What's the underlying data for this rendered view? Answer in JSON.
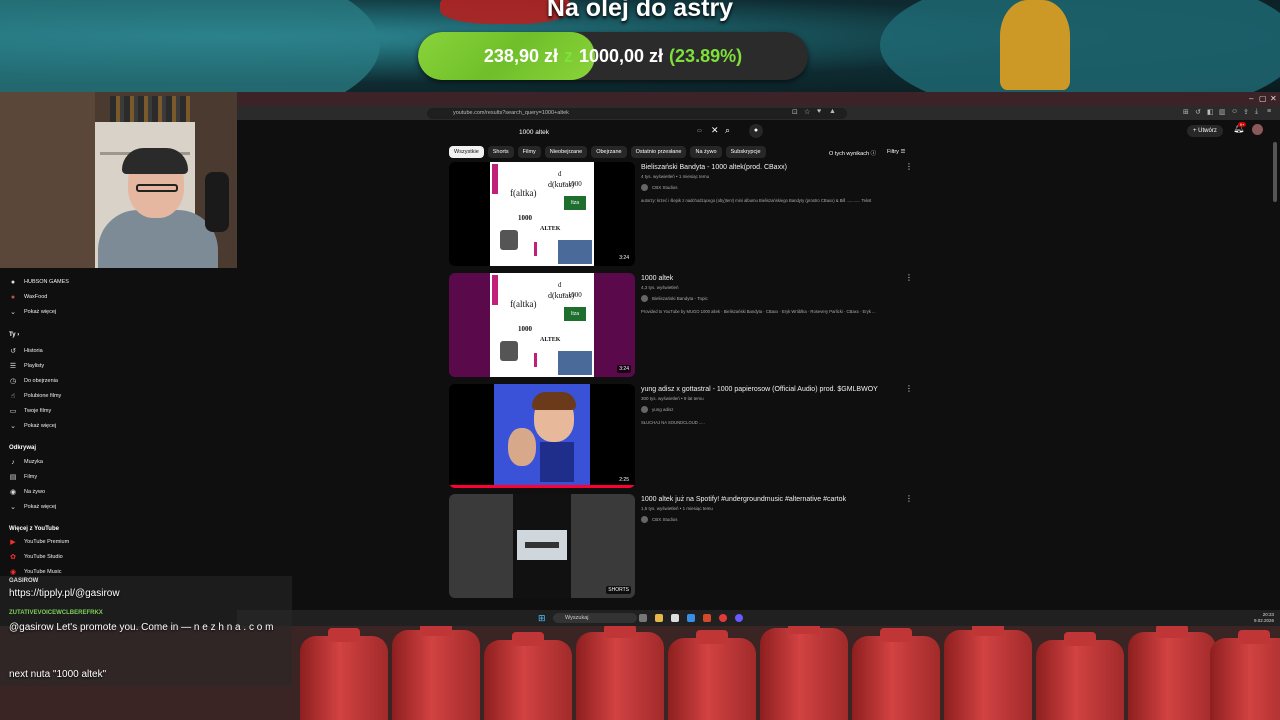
{
  "overlay": {
    "goal_title": "Na olej do astry",
    "goal_current": "238,90 zł",
    "goal_sep": "z",
    "goal_target": "1000,00 zł",
    "goal_percent": "(23.89%)",
    "goal_fraction": 0.2389,
    "accent": "#7ee03a"
  },
  "browser": {
    "url": "youtube.com/results?search_query=1000+altek"
  },
  "youtube": {
    "search_value": "1000 altek",
    "create_label": "Utwórz",
    "notification_count": "9+",
    "chips": [
      "Wszystkie",
      "Shorts",
      "Filmy",
      "Nieobejrzane",
      "Obejrzane",
      "Ostatnio przesłane",
      "Na żywo",
      "Subskrypcje"
    ],
    "about_results": "O tych wynikach",
    "filters_label": "Filtry",
    "results": [
      {
        "title": "Bieliszański Bandyta - 1000 altek(prod. CBaxx)",
        "meta": "4 tys. wyświetleń • 1 miesiąc temu",
        "channel": "CBX Studios",
        "desc": "autorzy: krzeć i ślepik z nadchodzącego (oby)ten!) mini albumu Bieliszańskiego Bandyty (prostro CBaxx) & Bill ............ Tekst",
        "duration": "3:24"
      },
      {
        "title": "1000 altek",
        "meta": "4,3 tys. wyświetleń",
        "channel": "Bieliszański Bandyta - Topic",
        "desc": "Provided to YouTube by MUGO 1000 altek · Bieliszański Bandyta · CBaxx · Eryk Wróblka · Rosevery Parlicki · CBaxx · Eryk ...",
        "duration": "3:24"
      },
      {
        "title": "yung adisz x gottastral - 1000 papierosow (Official Audio) prod. $GMLBWOY",
        "meta": "300 tys. wyświetleń • 9 lat temu",
        "channel": "yung adisz",
        "desc": "SŁUCHAJ NA SOUNDCLOUD .....",
        "duration": "2:25"
      },
      {
        "title": "1000 altek już na Spotify! #undergroundmusic #alternative #cartok",
        "meta": "1,5 tys. wyświetleń • 1 miesiąc temu",
        "channel": "CBX Studios",
        "desc": "",
        "duration": "SHORTS"
      }
    ],
    "thumb_text": {
      "altka": "f(altka)",
      "kutas": "d(kutas)",
      "d": "d",
      "eq1000": "= 1000",
      "n1000": "1000",
      "altek": "ALTEK",
      "sign": "Itza"
    }
  },
  "sidebar": {
    "top_items": [
      "HUBSON GAMES",
      "WaxFood",
      "Pokaż więcej"
    ],
    "you_header": "Ty",
    "you_items": [
      "Historia",
      "Playlisty",
      "Do obejrzenia",
      "Polubione filmy",
      "Twoje filmy",
      "Pokaż więcej"
    ],
    "explore_header": "Odkrywaj",
    "explore_items": [
      "Muzyka",
      "Filmy",
      "Na żywo",
      "Pokaż więcej"
    ],
    "more_header": "Więcej z YouTube",
    "more_items": [
      "YouTube Premium",
      "YouTube Studio",
      "YouTube Music"
    ]
  },
  "chat": {
    "user1": "GASIROW",
    "msg1": "https://tipply.pl/@gasirow",
    "user2": "ZUTATIVEVOICEWCLBEREFRKX",
    "msg2": "@gasirow Let's promote you. Come in — n e z h n a . c o m",
    "msg3": "next nuta \"1000 altek\""
  },
  "taskbar": {
    "search_label": "Wyszukaj",
    "time": "20:33",
    "date": "9.02.2026"
  }
}
